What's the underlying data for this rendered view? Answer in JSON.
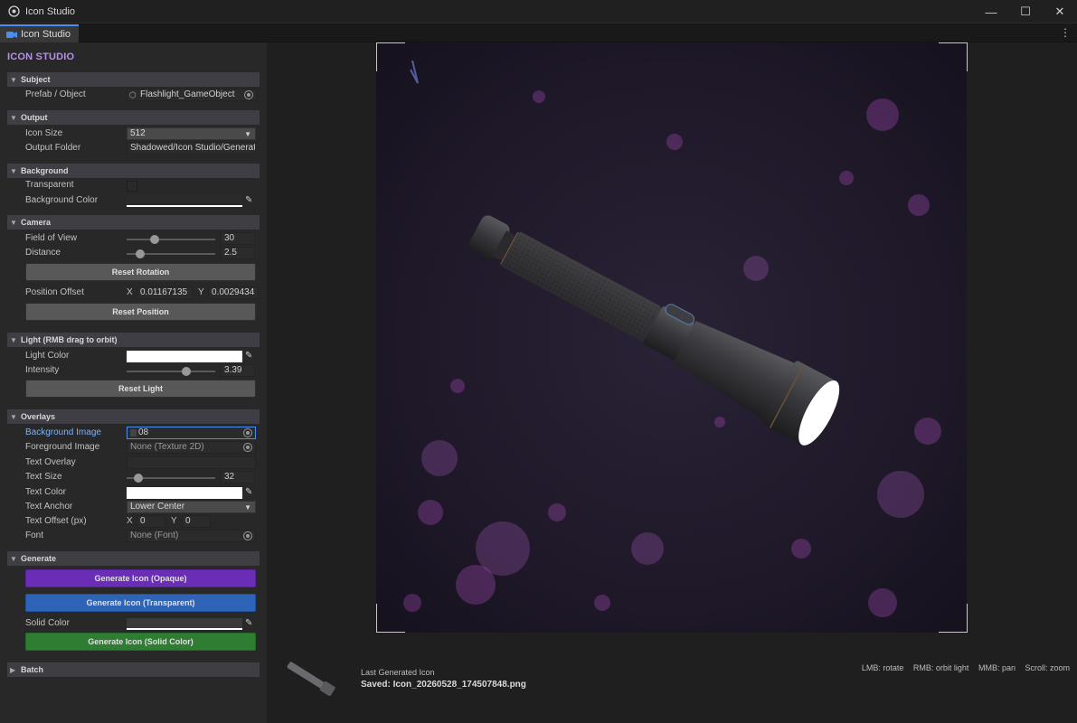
{
  "window": {
    "title": "Icon Studio",
    "minimize": "—",
    "maximize": "☐",
    "close": "✕"
  },
  "tab": {
    "label": "Icon Studio",
    "menu": "⋮"
  },
  "panel": {
    "title": "ICON STUDIO"
  },
  "sections": {
    "subject": "Subject",
    "output": "Output",
    "background": "Background",
    "camera": "Camera",
    "light": "Light (RMB drag to orbit)",
    "overlays": "Overlays",
    "generate": "Generate",
    "batch": "Batch"
  },
  "subject": {
    "prefab_label": "Prefab / Object",
    "prefab_value": "Flashlight_GameObject"
  },
  "output": {
    "icon_size_label": "Icon Size",
    "icon_size_value": "512",
    "folder_label": "Output Folder",
    "folder_value": "Shadowed/Icon Studio/Generated"
  },
  "background": {
    "transparent_label": "Transparent",
    "color_label": "Background Color",
    "color": "#ffffff",
    "transparent": false
  },
  "camera": {
    "fov_label": "Field of View",
    "fov_value": "30",
    "fov_fraction": 0.32,
    "distance_label": "Distance",
    "distance_value": "2.5",
    "distance_fraction": 0.16,
    "reset_rotation": "Reset Rotation",
    "offset_label": "Position Offset",
    "x_label": "X",
    "x_value": "0.01167135",
    "y_label": "Y",
    "y_value": "0.0029434",
    "reset_position": "Reset Position"
  },
  "light": {
    "color_label": "Light Color",
    "color": "#ffffff",
    "intensity_label": "Intensity",
    "intensity_value": "3.39",
    "intensity_fraction": 0.68,
    "reset": "Reset Light"
  },
  "overlays": {
    "bg_image_label": "Background Image",
    "bg_image_value": "08",
    "fg_image_label": "Foreground Image",
    "fg_image_value": "None (Texture 2D)",
    "text_overlay_label": "Text Overlay",
    "text_overlay_value": "",
    "text_size_label": "Text Size",
    "text_size_value": "32",
    "text_size_fraction": 0.14,
    "text_color_label": "Text Color",
    "text_color": "#ffffff",
    "anchor_label": "Text Anchor",
    "anchor_value": "Lower Center",
    "offset_label": "Text Offset (px)",
    "x_label": "X",
    "x_value": "0",
    "y_label": "Y",
    "y_value": "0",
    "font_label": "Font",
    "font_value": "None (Font)"
  },
  "generate": {
    "opaque": "Generate Icon (Opaque)",
    "transparent": "Generate Icon (Transparent)",
    "solid_color_label": "Solid Color",
    "solid": "Generate Icon (Solid Color)"
  },
  "viewport": {
    "hint_lmb": "LMB: rotate",
    "hint_rmb": "RMB: orbit light",
    "hint_mmb": "MMB: pan",
    "hint_scroll": "Scroll: zoom"
  },
  "last": {
    "label": "Last Generated Icon",
    "saved": "Saved: Icon_20260528_174507848.png"
  },
  "colors": {
    "accent_purple": "#b68ef0",
    "opaque_btn": "#6a2db5",
    "transparent_btn": "#2f63b5",
    "solid_btn": "#2e7d32",
    "tab_accent": "#4a8ff0"
  }
}
